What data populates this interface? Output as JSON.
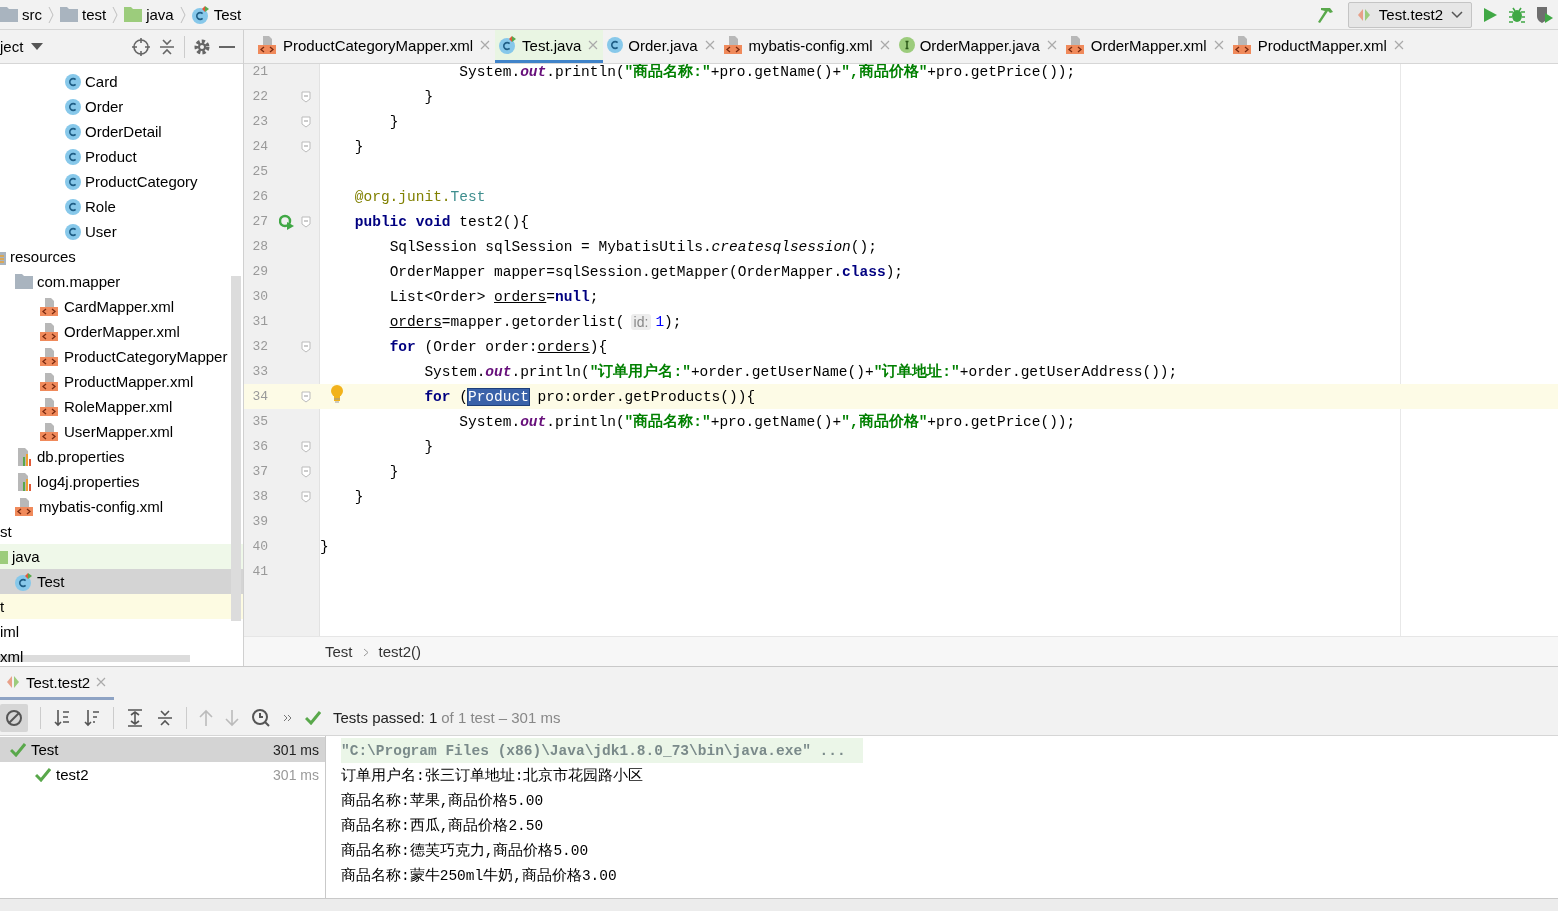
{
  "nav": {
    "crumbs": [
      {
        "label": "src",
        "kind": "folder"
      },
      {
        "label": "test",
        "kind": "folder"
      },
      {
        "label": "java",
        "kind": "test-root"
      },
      {
        "label": "Test",
        "kind": "test-class"
      }
    ],
    "run_config": "Test.test2"
  },
  "project": {
    "title": "ject",
    "tree": [
      {
        "children": [
          {
            "children": [
              {
                "children": [
                  {
                    "children": [
                      {
                        "label": "Card",
                        "kind": "class"
                      },
                      {
                        "label": "Order",
                        "kind": "class"
                      },
                      {
                        "label": "OrderDetail",
                        "kind": "class"
                      },
                      {
                        "label": "Product",
                        "kind": "class"
                      },
                      {
                        "label": "ProductCategory",
                        "kind": "class"
                      },
                      {
                        "label": "Role",
                        "kind": "class"
                      },
                      {
                        "label": "User",
                        "kind": "class"
                      }
                    ]
                  }
                ]
              }
            ]
          },
          {
            "label": "resources",
            "kind": "resources",
            "children": [
              {
                "label": "com.mapper",
                "kind": "folder",
                "children": [
                  {
                    "label": "CardMapper.xml",
                    "kind": "xml"
                  },
                  {
                    "label": "OrderMapper.xml",
                    "kind": "xml"
                  },
                  {
                    "label": "ProductCategoryMapper",
                    "kind": "xml"
                  },
                  {
                    "label": "ProductMapper.xml",
                    "kind": "xml"
                  },
                  {
                    "label": "RoleMapper.xml",
                    "kind": "xml"
                  },
                  {
                    "label": "UserMapper.xml",
                    "kind": "xml"
                  }
                ]
              },
              {
                "label": "db.properties",
                "kind": "properties"
              },
              {
                "label": "log4j.properties",
                "kind": "properties"
              },
              {
                "label": "mybatis-config.xml",
                "kind": "xml"
              }
            ]
          }
        ]
      },
      {
        "label": "st",
        "kind": "plain",
        "children": [
          {
            "label": "java",
            "kind": "test-root",
            "children": [
              {
                "label": "Test",
                "kind": "test-class",
                "selected": true
              }
            ]
          }
        ]
      },
      {
        "label": "t",
        "kind": "excluded"
      },
      {
        "label": "iml",
        "kind": "plain"
      },
      {
        "label": "xml",
        "kind": "plain"
      }
    ]
  },
  "tabs": [
    {
      "label": "ProductCategoryMapper.xml",
      "kind": "xml",
      "selected": false
    },
    {
      "label": "Test.java",
      "kind": "test-class",
      "selected": true
    },
    {
      "label": "Order.java",
      "kind": "class",
      "selected": false
    },
    {
      "label": "mybatis-config.xml",
      "kind": "xml",
      "selected": false
    },
    {
      "label": "OrderMapper.java",
      "kind": "interface",
      "selected": false
    },
    {
      "label": "OrderMapper.xml",
      "kind": "xml",
      "selected": false
    },
    {
      "label": "ProductMapper.xml",
      "kind": "xml",
      "selected": false
    }
  ],
  "code": [
    {
      "num": "21",
      "tokens": [
        {
          "kind": "plain",
          "text": "                System."
        },
        {
          "kind": "field",
          "text": "out"
        },
        {
          "kind": "plain",
          "text": ".println("
        },
        {
          "kind": "string",
          "text": "\"商品名称:\""
        },
        {
          "kind": "plain",
          "text": "+pro.getName()+"
        },
        {
          "kind": "string",
          "text": "\",商品价格\""
        },
        {
          "kind": "plain",
          "text": "+pro.getPrice());"
        }
      ]
    },
    {
      "num": "22",
      "fold": true,
      "tokens": [
        {
          "kind": "plain",
          "text": "            }"
        }
      ]
    },
    {
      "num": "23",
      "fold": true,
      "tokens": [
        {
          "kind": "plain",
          "text": "        }"
        }
      ]
    },
    {
      "num": "24",
      "fold": true,
      "tokens": [
        {
          "kind": "plain",
          "text": "    }"
        }
      ]
    },
    {
      "num": "25"
    },
    {
      "num": "26",
      "tokens": [
        {
          "kind": "annotation",
          "text": "    @org.junit."
        },
        {
          "kind": "type",
          "text": "Test"
        }
      ]
    },
    {
      "num": "27",
      "fold": true,
      "runnable": true,
      "tokens": [
        {
          "kind": "keyword",
          "text": "    public void"
        },
        {
          "kind": "plain",
          "text": " test2(){"
        }
      ]
    },
    {
      "num": "28",
      "tokens": [
        {
          "kind": "plain",
          "text": "        SqlSession sqlSession = MybatisUtils."
        },
        {
          "kind": "italic",
          "text": "createsqlsession"
        },
        {
          "kind": "plain",
          "text": "();"
        }
      ]
    },
    {
      "num": "29",
      "tokens": [
        {
          "kind": "plain",
          "text": "        OrderMapper mapper=sqlSession.getMapper(OrderMapper."
        },
        {
          "kind": "keyword",
          "text": "class"
        },
        {
          "kind": "plain",
          "text": ");"
        }
      ]
    },
    {
      "num": "30",
      "tokens": [
        {
          "kind": "plain",
          "text": "        List<Order> "
        },
        {
          "kind": "underline",
          "text": "orders"
        },
        {
          "kind": "plain",
          "text": "="
        },
        {
          "kind": "keyword",
          "text": "null"
        },
        {
          "kind": "plain",
          "text": ";"
        }
      ]
    },
    {
      "num": "31",
      "tokens": [
        {
          "kind": "underline",
          "text": "        orders"
        },
        {
          "kind": "plain",
          "text": "=mapper.getorderlist("
        },
        {
          "kind": "hint",
          "text": "id:"
        },
        {
          "kind": "number",
          "text": "1"
        },
        {
          "kind": "plain",
          "text": ");"
        }
      ]
    },
    {
      "num": "32",
      "fold": true,
      "tokens": [
        {
          "kind": "keyword",
          "text": "        for"
        },
        {
          "kind": "plain",
          "text": " (Order order:"
        },
        {
          "kind": "underline",
          "text": "orders"
        },
        {
          "kind": "plain",
          "text": "){"
        }
      ]
    },
    {
      "num": "33",
      "tokens": [
        {
          "kind": "plain",
          "text": "            System."
        },
        {
          "kind": "field",
          "text": "out"
        },
        {
          "kind": "plain",
          "text": ".println("
        },
        {
          "kind": "string",
          "text": "\"订单用户名:\""
        },
        {
          "kind": "plain",
          "text": "+order.getUserName()+"
        },
        {
          "kind": "string",
          "text": "\"订单地址:\""
        },
        {
          "kind": "plain",
          "text": "+order.getUserAddress());"
        }
      ]
    },
    {
      "num": "34",
      "fold": true,
      "intention": true,
      "current": true,
      "tokens": [
        {
          "kind": "keyword",
          "text": "            for"
        },
        {
          "kind": "plain",
          "text": " ("
        },
        {
          "kind": "selection",
          "text": "Product"
        },
        {
          "kind": "plain",
          "text": " pro:order.getProducts()){"
        }
      ]
    },
    {
      "num": "35",
      "tokens": [
        {
          "kind": "plain",
          "text": "                System."
        },
        {
          "kind": "field",
          "text": "out"
        },
        {
          "kind": "plain",
          "text": ".println("
        },
        {
          "kind": "string",
          "text": "\"商品名称:\""
        },
        {
          "kind": "plain",
          "text": "+pro.getName()+"
        },
        {
          "kind": "string",
          "text": "\",商品价格\""
        },
        {
          "kind": "plain",
          "text": "+pro.getPrice());"
        }
      ]
    },
    {
      "num": "36",
      "fold": true,
      "tokens": [
        {
          "kind": "plain",
          "text": "            }"
        }
      ]
    },
    {
      "num": "37",
      "fold": true,
      "tokens": [
        {
          "kind": "plain",
          "text": "        }"
        }
      ]
    },
    {
      "num": "38",
      "fold": true,
      "tokens": [
        {
          "kind": "plain",
          "text": "    }"
        }
      ]
    },
    {
      "num": "39"
    },
    {
      "num": "40",
      "tokens": [
        {
          "kind": "plain",
          "text": "}"
        }
      ]
    },
    {
      "num": "41"
    }
  ],
  "editor_breadcrumb": [
    "Test",
    "test2()"
  ],
  "run": {
    "tab": "Test.test2",
    "summary": "Tests passed: 1",
    "summary_detail": "of 1 test – 301 ms",
    "tests": [
      {
        "label": "Test",
        "time": "301 ms",
        "passed": true,
        "selected": true,
        "children": [
          {
            "label": "test2",
            "time": "301 ms",
            "passed": true,
            "selected": false
          }
        ]
      }
    ],
    "console": [
      {
        "kind": "command",
        "text": "\"C:\\Program Files (x86)\\Java\\jdk1.8.0_73\\bin\\java.exe\" ..."
      },
      {
        "kind": "out",
        "text": "订单用户名:张三订单地址:北京市花园路小区"
      },
      {
        "kind": "out",
        "text": "商品名称:苹果,商品价格5.00"
      },
      {
        "kind": "out",
        "text": "商品名称:西瓜,商品价格2.50"
      },
      {
        "kind": "out",
        "text": "商品名称:德芙巧克力,商品价格5.00"
      },
      {
        "kind": "out",
        "text": "商品名称:蒙牛250ml牛奶,商品价格3.00"
      }
    ]
  }
}
